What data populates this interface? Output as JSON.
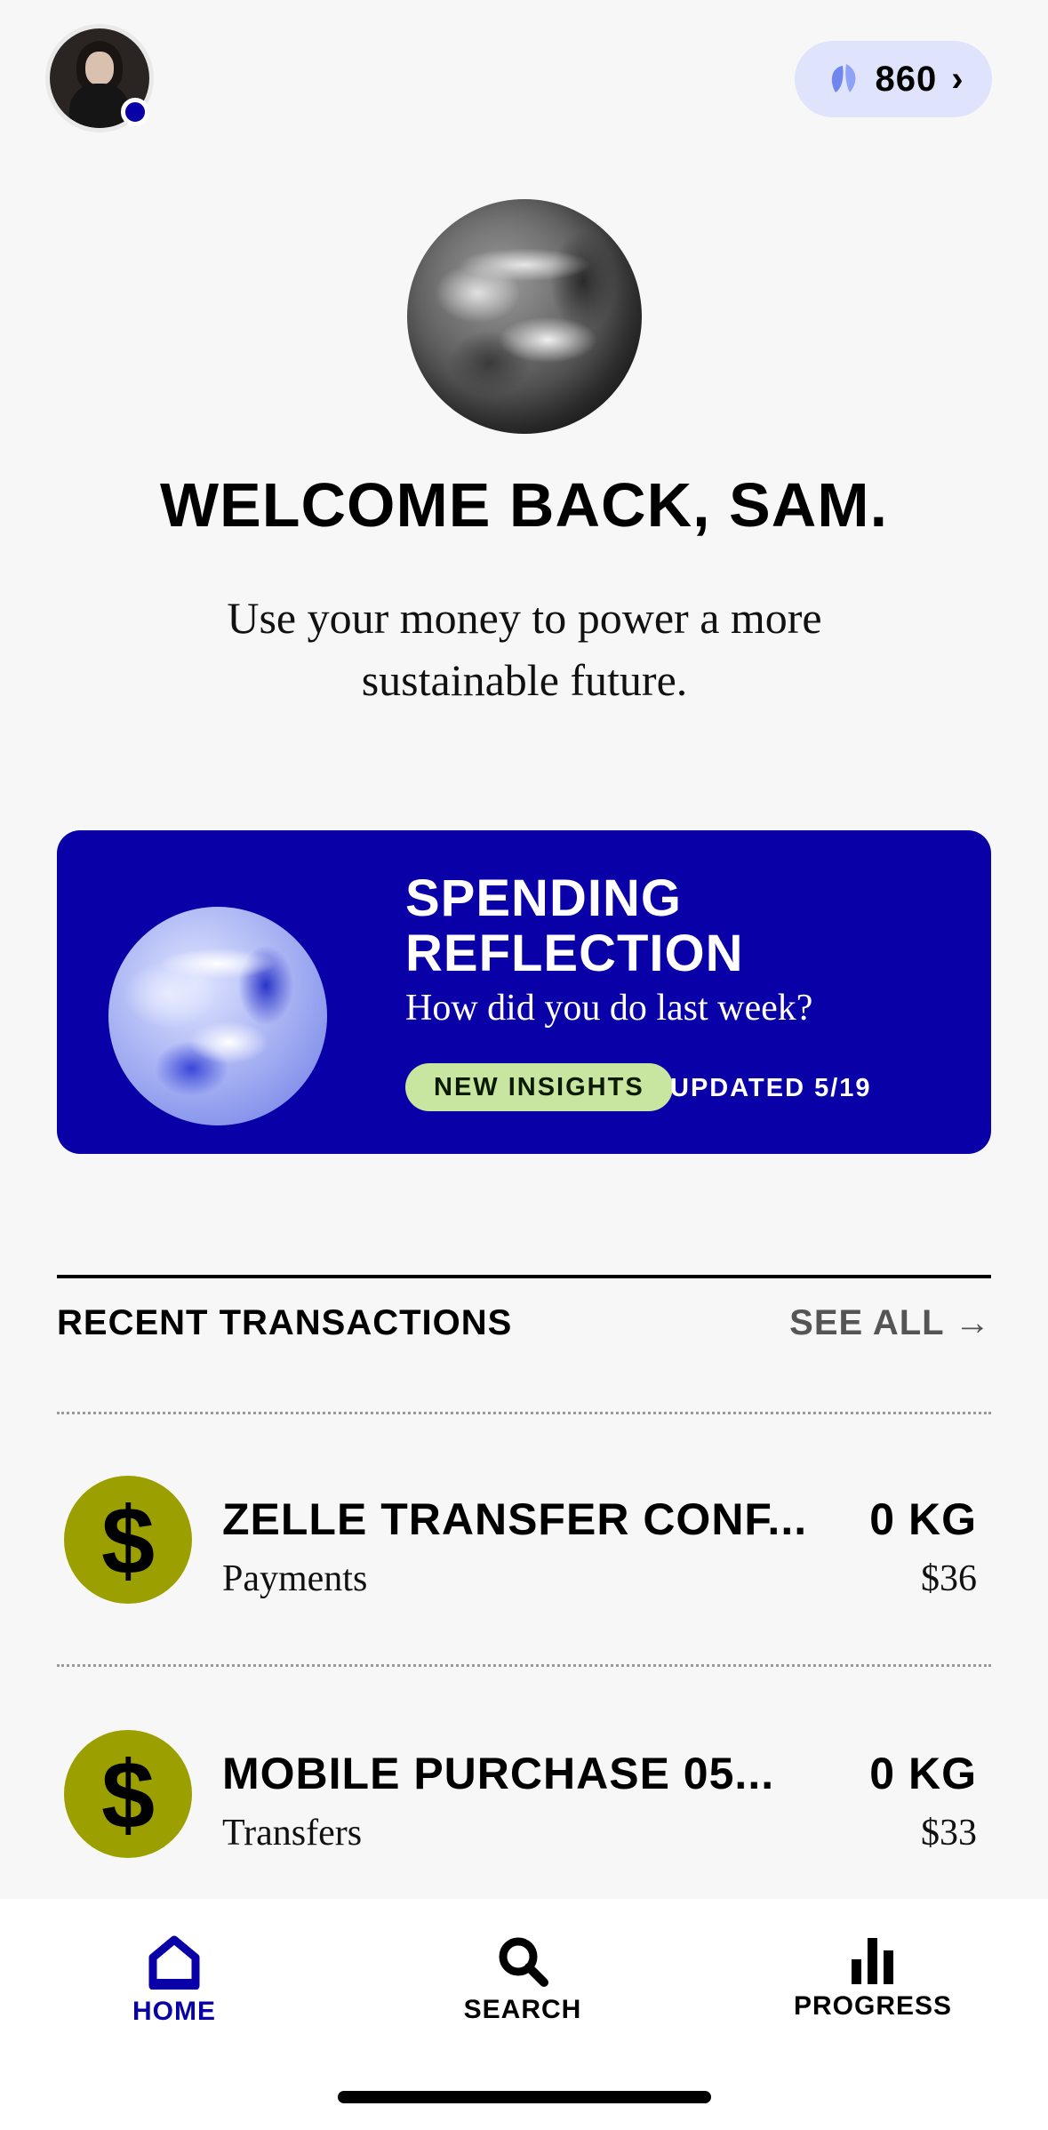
{
  "header": {
    "points": "860"
  },
  "hero": {
    "welcome": "WELCOME BACK, SAM.",
    "tagline": "Use your money to power a more sustainable future."
  },
  "reflection_card": {
    "title": "SPENDING REFLECTION",
    "subtitle": "How did you do last week?",
    "badge": "NEW INSIGHTS",
    "updated": "UPDATED 5/19"
  },
  "transactions": {
    "title": "RECENT TRANSACTIONS",
    "see_all": "SEE ALL",
    "see_all_icon": "arrow-right-icon",
    "items": [
      {
        "name": "ZELLE TRANSFER CONF...",
        "category": "Payments",
        "emissions": "0 KG",
        "amount": "$36",
        "icon": "$"
      },
      {
        "name": "MOBILE PURCHASE 05...",
        "category": "Transfers",
        "emissions": "0 KG",
        "amount": "$33",
        "icon": "$"
      }
    ]
  },
  "tabbar": {
    "home": "HOME",
    "search": "SEARCH",
    "progress": "PROGRESS"
  },
  "colors": {
    "brand_blue": "#0a00a8",
    "badge_green": "#c8e6a0",
    "txn_icon_olive": "#9ba000",
    "points_pill": "#dfe3fb"
  }
}
